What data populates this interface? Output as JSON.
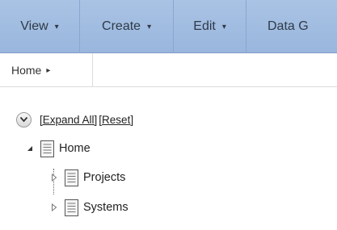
{
  "menubar": {
    "items": [
      {
        "label": "View",
        "arrow": "▾"
      },
      {
        "label": "Create",
        "arrow": "▾"
      },
      {
        "label": "Edit",
        "arrow": "▾"
      },
      {
        "label": "Data G",
        "arrow": ""
      }
    ],
    "colors": {
      "background": "#a9c3e4",
      "border": "#8aa6cf",
      "text": "#2f3a48"
    }
  },
  "breadcrumb": {
    "label": "Home",
    "arrow": "▸"
  },
  "tree": {
    "expand_all_label": "[Expand All]",
    "reset_label": "[Reset]",
    "nodes": [
      {
        "label": "Home",
        "expander": "◢",
        "icon": "document-icon"
      },
      {
        "label": "Projects",
        "expander": "▷",
        "icon": "document-icon"
      },
      {
        "label": "Systems",
        "expander": "▷",
        "icon": "document-icon"
      }
    ]
  }
}
